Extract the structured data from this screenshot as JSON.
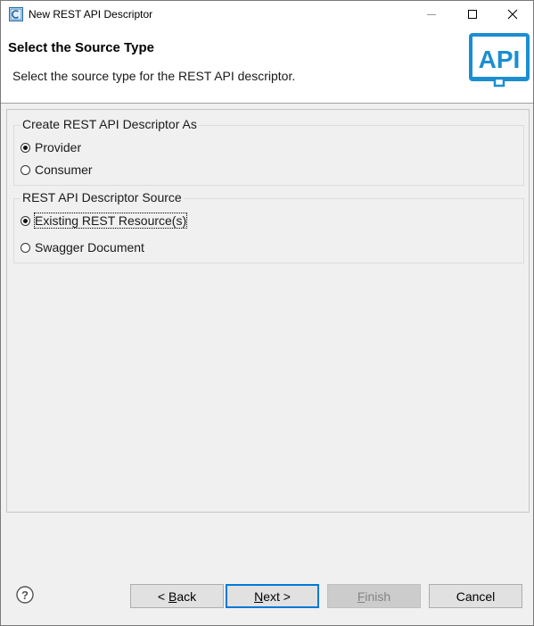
{
  "window": {
    "title": "New REST API Descriptor",
    "icons": {
      "app": "app-icon",
      "minimize": "minimize-icon",
      "maximize": "maximize-icon",
      "close": "close-icon"
    }
  },
  "header": {
    "title": "Select the Source Type",
    "description": "Select the source type for the REST API descriptor.",
    "logo_text": "API",
    "logo_color": "#1b8ed1"
  },
  "group_create": {
    "legend": "Create REST API Descriptor As",
    "options": [
      {
        "label": "Provider",
        "checked": true
      },
      {
        "label": "Consumer",
        "checked": false
      }
    ]
  },
  "group_source": {
    "legend": "REST API Descriptor Source",
    "options": [
      {
        "label": "Existing REST Resource(s)",
        "checked": true
      },
      {
        "label": "Swagger Document",
        "checked": false
      }
    ]
  },
  "footer": {
    "help_icon": "help-icon",
    "buttons": {
      "back": {
        "prefix": "< ",
        "mnemonic": "B",
        "rest": "ack"
      },
      "next": {
        "prefix": "",
        "mnemonic": "N",
        "rest": "ext >"
      },
      "finish": {
        "prefix": "",
        "mnemonic": "F",
        "rest": "inish",
        "enabled": false
      },
      "cancel": "Cancel"
    }
  }
}
